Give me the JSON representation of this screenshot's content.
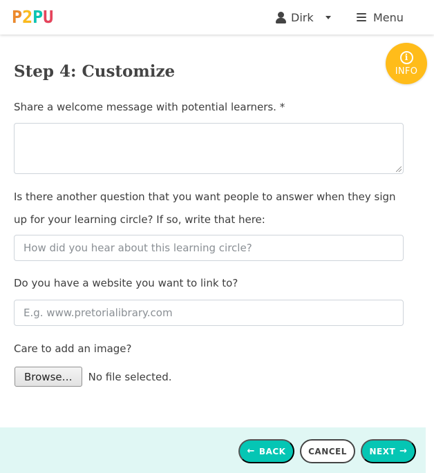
{
  "navbar": {
    "logo_letters": [
      "P",
      "2",
      "P",
      "U"
    ],
    "logo_colors": [
      "#ef8a2c",
      "#ffbc1a",
      "#05c6b4",
      "#e8445c"
    ],
    "user_name": "Dirk",
    "menu_label": "Menu",
    "icons": {
      "user": "user-icon",
      "caret": "caret-down-icon",
      "menu": "hamburger-icon"
    }
  },
  "info_badge": {
    "label": "INFO",
    "glyph": "i",
    "color": "#ffbc1a"
  },
  "form": {
    "title": "Step 4: Customize",
    "welcome_label": "Share a welcome message with potential learners. *",
    "welcome_value": "",
    "question_label": "Is there another question that you want people to answer when they sign up for your learning circle? If so, write that here:",
    "question_placeholder": "How did you hear about this learning circle?",
    "website_label": "Do you have a website you want to link to?",
    "website_placeholder": "E.g. www.pretorialibrary.com",
    "image_label": "Care to add an image?",
    "browse_label": "Browse…",
    "file_status": "No file selected."
  },
  "footer": {
    "back_label": "BACK",
    "cancel_label": "CANCEL",
    "next_label": "NEXT",
    "accent_color": "#05c6b4",
    "background_color": "#e0f7f4"
  }
}
